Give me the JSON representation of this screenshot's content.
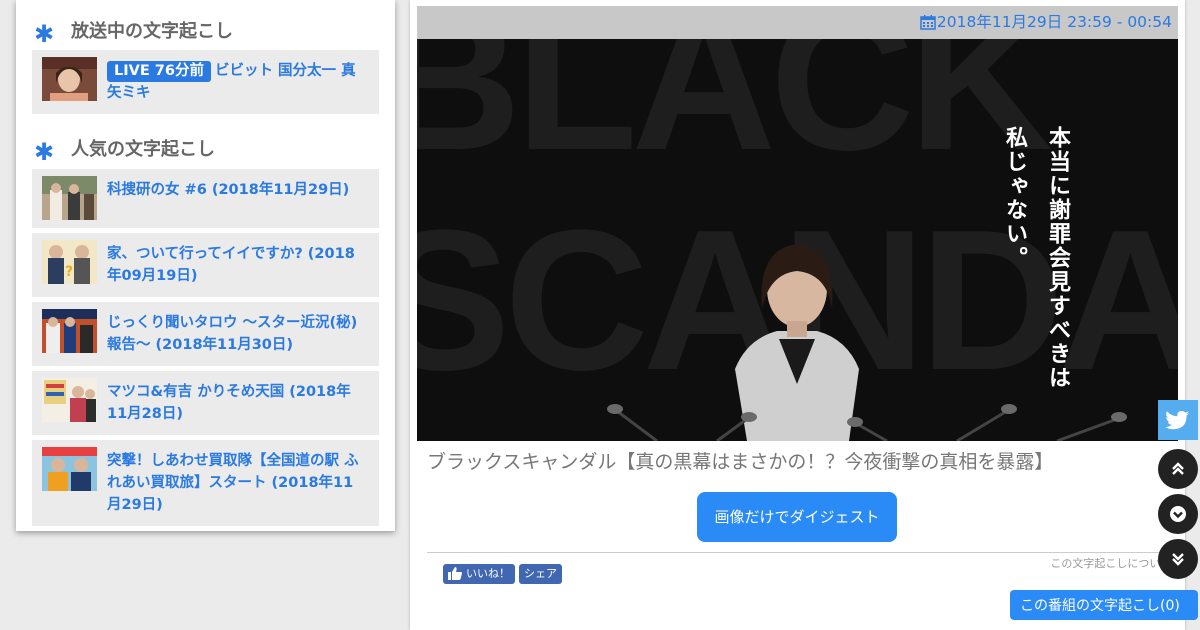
{
  "sidebar": {
    "live_section_title": "放送中の文字起こし",
    "live_item": {
      "badge": "LIVE 76分前",
      "title": "ビビット 国分太一 真矢ミキ"
    },
    "popular_section_title": "人気の文字起こし",
    "popular_items": [
      {
        "title": "科捜研の女 #6 (2018年11月29日)"
      },
      {
        "title": "家、ついて行ってイイですか? (2018年09月19日)"
      },
      {
        "title": "じっくり聞いタロウ ～スター近況(秘)報告～ (2018年11月30日)"
      },
      {
        "title": "マツコ&有吉 かりそめ天国 (2018年11月28日)"
      },
      {
        "title": "突撃！しあわせ買取隊【全国道の駅 ふれあい買取旅】スタート (2018年11月29日)"
      }
    ]
  },
  "main": {
    "broadcast_time": "2018年11月29日 23:59 - 00:54",
    "hero": {
      "background_letters": "BLACK SCANDAL",
      "tagline_col1": "本当に謝罪会見すべきは",
      "tagline_col2": "私じゃない。"
    },
    "program_title": "ブラックスキャンダル【真の黒幕はまさかの！？今夜衝撃の真相を暴露】",
    "digest_button": "画像だけでダイジェスト",
    "about_link": "この文字起こしについて",
    "fb_like": "いいね！",
    "fb_share": "シェア",
    "transcript_button": "この番組の文字起こし(0)"
  },
  "icons": {
    "accent": "#2a7ae2",
    "twitter": "twitter-icon",
    "page_up": "double-chevron-up-icon",
    "scroll_down": "chevron-down-circle-icon",
    "page_down": "double-chevron-down-icon"
  }
}
